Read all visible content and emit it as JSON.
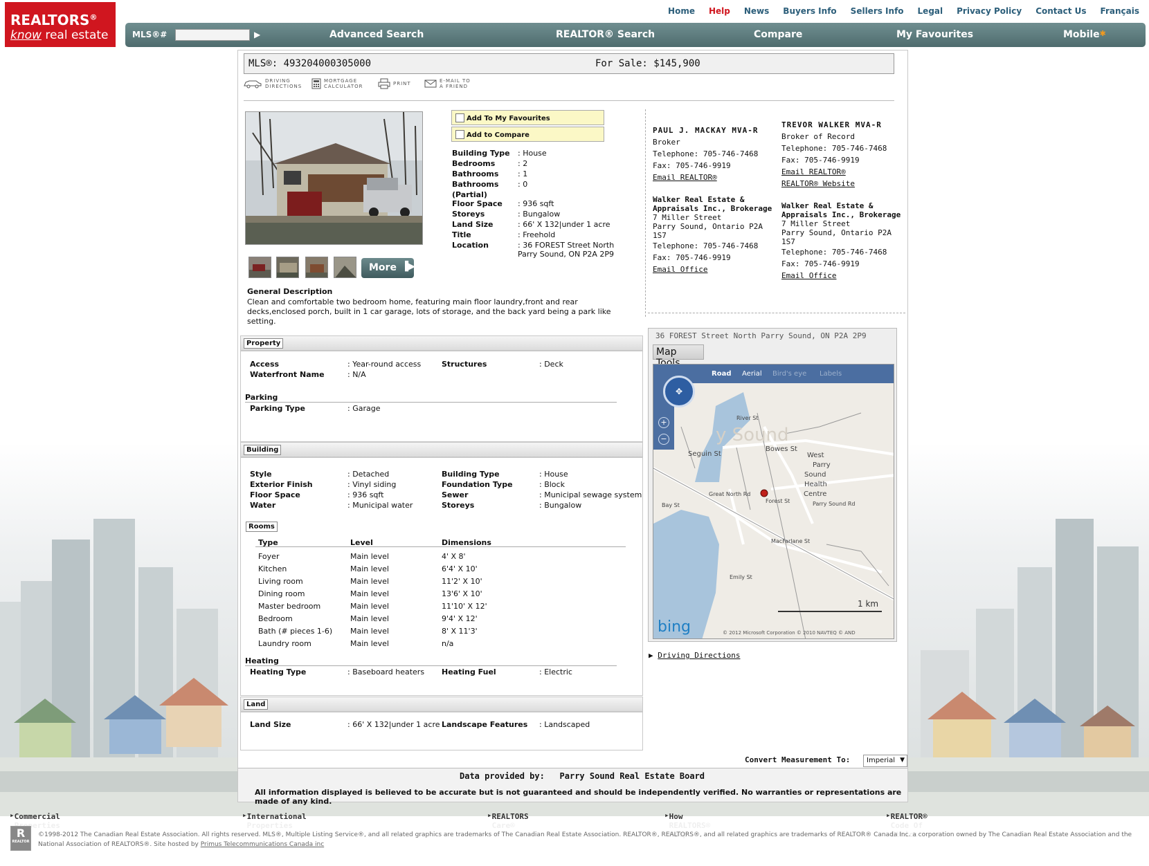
{
  "logo": {
    "line1": "REALTORS",
    "reg": "®",
    "know": "know",
    "rest": " real estate"
  },
  "topnav": [
    "Home",
    "Help",
    "News",
    "Buyers Info",
    "Sellers Info",
    "Legal",
    "Privacy Policy",
    "Contact Us",
    "Français"
  ],
  "mainnav": {
    "mls_label": "MLS®#",
    "mls_placeholder": "",
    "items": [
      "Advanced Search",
      "REALTOR® Search",
      "Compare",
      "My Favourites",
      "Mobile"
    ]
  },
  "listing": {
    "mls": "MLS®: 493204000305000",
    "price": "For Sale: $145,900"
  },
  "tools": [
    {
      "l1": "DRIVING",
      "l2": "DIRECTIONS",
      "icon": "car-icon"
    },
    {
      "l1": "MORTGAGE",
      "l2": "CALCULATOR",
      "icon": "calculator-icon"
    },
    {
      "l1": "PRINT",
      "l2": "",
      "icon": "print-icon"
    },
    {
      "l1": "E-MAIL TO",
      "l2": "A FRIEND",
      "icon": "email-icon"
    }
  ],
  "photos": {
    "more_label": "More",
    "count_thumbs": 4
  },
  "actions": {
    "favourites": "Add To My Favourites",
    "compare": "Add to Compare"
  },
  "summary": [
    {
      "k": "Building Type",
      "v": ": House"
    },
    {
      "k": "Bedrooms",
      "v": ": 2"
    },
    {
      "k": "Bathrooms",
      "v": ": 1"
    },
    {
      "k": "Bathrooms (Partial)",
      "v": ": 0"
    },
    {
      "k": "Floor Space",
      "v": ": 936 sqft"
    },
    {
      "k": "Storeys",
      "v": ": Bungalow"
    },
    {
      "k": "Land Size",
      "v": ": 66' X 132|under 1 acre"
    },
    {
      "k": "Title",
      "v": ": Freehold"
    },
    {
      "k": "Location",
      "v": ": 36 FOREST Street North"
    }
  ],
  "location_line2": "Parry Sound, ON   P2A 2P9",
  "description": {
    "title": "General Description",
    "text": "Clean and comfortable two bedroom home, featuring main floor laundry,front and rear decks,enclosed porch, built in 1 car garage, lots of storage, and the back yard being a park like setting."
  },
  "agents": [
    {
      "name": "PAUL J. MACKAY  MVA-R",
      "role": "Broker",
      "tel": "Telephone: 705-746-7468",
      "fax": "Fax: 705-746-9919",
      "email": "Email REALTOR®",
      "website": "",
      "co1": "Walker Real Estate &",
      "co2": "Appraisals Inc., Brokerage",
      "addr1": "7 Miller Street",
      "addr2": "Parry Sound, Ontario   P2A",
      "addr3": "1S7",
      "otel": "Telephone: 705-746-7468",
      "ofax": "Fax: 705-746-9919",
      "oemail": "Email Office"
    },
    {
      "name": "TREVOR WALKER  MVA-R",
      "role": "Broker of Record",
      "tel": "Telephone: 705-746-7468",
      "fax": "Fax: 705-746-9919",
      "email": "Email REALTOR®",
      "website": "REALTOR® Website",
      "co1": "Walker Real Estate &",
      "co2": "Appraisals Inc., Brokerage",
      "addr1": "7 Miller Street",
      "addr2": "Parry Sound, Ontario   P2A",
      "addr3": "1S7",
      "otel": "Telephone: 705-746-7468",
      "ofax": "Fax: 705-746-9919",
      "oemail": "Email Office"
    }
  ],
  "property": {
    "label": "Property",
    "rows": [
      {
        "k": "Access",
        "v": ": Year-round access",
        "k2": "Structures",
        "v2": ": Deck"
      },
      {
        "k": "Waterfront Name",
        "v": ": N/A",
        "k2": "",
        "v2": ""
      }
    ],
    "parking_head": "Parking",
    "parking": {
      "k": "Parking Type",
      "v": ": Garage"
    }
  },
  "building": {
    "label": "Building",
    "rows": [
      {
        "k": "Style",
        "v": ": Detached",
        "k2": "Building Type",
        "v2": ": House"
      },
      {
        "k": "Exterior Finish",
        "v": ": Vinyl siding",
        "k2": "Foundation Type",
        "v2": ": Block"
      },
      {
        "k": "Floor Space",
        "v": ": 936 sqft",
        "k2": "Sewer",
        "v2": ": Municipal sewage system"
      },
      {
        "k": "Water",
        "v": ": Municipal water",
        "k2": "Storeys",
        "v2": ": Bungalow"
      }
    ],
    "rooms_label": "Rooms",
    "room_cols": [
      "Type",
      "Level",
      "Dimensions"
    ],
    "rooms": [
      [
        "Foyer",
        "Main level",
        "4' X 8'"
      ],
      [
        "Kitchen",
        "Main level",
        "6'4' X 10'"
      ],
      [
        "Living room",
        "Main level",
        "11'2' X 10'"
      ],
      [
        "Dining room",
        "Main level",
        "13'6' X 10'"
      ],
      [
        "Master bedroom",
        "Main level",
        "11'10' X 12'"
      ],
      [
        "Bedroom",
        "Main level",
        "9'4' X 12'"
      ],
      [
        "Bath (# pieces 1-6)",
        "Main level",
        "8' X 11'3'"
      ],
      [
        "Laundry room",
        "Main level",
        "n/a"
      ]
    ],
    "heating_head": "Heating",
    "heating": {
      "k": "Heating Type",
      "v": ": Baseboard heaters",
      "k2": "Heating Fuel",
      "v2": ": Electric"
    }
  },
  "land": {
    "label": "Land",
    "row": {
      "k": "Land Size",
      "v": ": 66' X 132|under 1 acre",
      "k2": "Landscape Features",
      "v2": ": Landscaped"
    }
  },
  "map": {
    "address": "36 FOREST Street North Parry Sound, ON   P2A 2P9",
    "tools_label": "Map Tools",
    "modes": [
      "Road",
      "Aerial",
      "Bird's eye",
      "Labels"
    ],
    "labels": [
      "Seguin St",
      "Bowes St",
      "West",
      "Parry",
      "Sound",
      "Health",
      "Centre",
      "Parry Sound Rd",
      "Bay St",
      "Great North Rd",
      "Forest St",
      "MacFarlane St",
      "Emily St",
      "River St"
    ],
    "scale": "1 km",
    "brand": "bing",
    "credits": "© 2012 Microsoft Corporation    © 2010 NAVTEQ    © AND"
  },
  "driving_directions": "Driving Directions",
  "convert": {
    "label": "Convert Measurement To:",
    "value": "Imperial"
  },
  "provided": {
    "label": "Data provided by:",
    "board": "Parry Sound Real Estate Board",
    "disclaimer": "All information displayed is believed to be accurate but is not guaranteed and should be independently verified. No warranties or representations are made of any kind."
  },
  "footer_links": [
    "Commercial Properties",
    "International Properties",
    "REALTORS Care®",
    "How REALTORS® Help",
    "REALTOR® Code Of Ethics"
  ],
  "copyright": {
    "text1": "©1998-2012 The Canadian Real Estate Association. All rights reserved. MLS®, Multiple Listing Service®, and all related graphics are trademarks of The Canadian Real Estate Association. REALTOR®, REALTORS®, and all related graphics are trademarks of REALTOR® Canada Inc. a corporation owned by The Canadian Real Estate Association and the National Association of REALTORS®. Site hosted by ",
    "link": "Primus Telecommunications Canada inc",
    "logo_letter": "R",
    "logo_caption": "REALTOR"
  }
}
